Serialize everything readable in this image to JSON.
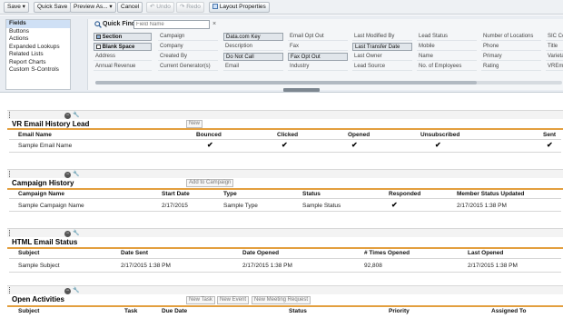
{
  "toolbar": {
    "save": "Save ▾",
    "quick_save": "Quick Save",
    "preview_as": "Preview As... ▾",
    "cancel": "Cancel",
    "undo": "Undo",
    "redo": "Redo",
    "layout_properties": "Layout Properties"
  },
  "palette": {
    "categories": [
      "Fields",
      "Buttons",
      "Actions",
      "Expanded Lookups",
      "Related Lists",
      "Report Charts",
      "Custom S-Controls"
    ],
    "selected_category": "Fields",
    "quick_find_label": "Quick Find",
    "quick_find_placeholder": "Field Name",
    "clear_icon": "×",
    "fields": [
      [
        "Section",
        "Campaign",
        "Data.com Key",
        "Email Opt Out",
        "Last Modified By",
        "Lead Status",
        "Number of Locations",
        "SIC Co"
      ],
      [
        "Blank Space",
        "Company",
        "Description",
        "Fax",
        "Last Transfer Date",
        "Mobile",
        "Phone",
        "Title"
      ],
      [
        "Address",
        "Created By",
        "Do Not Call",
        "Fax Opt Out",
        "Last Owner",
        "Name",
        "Primary",
        "Varieta"
      ],
      [
        "Annual Revenue",
        "Current Generator(s)",
        "Email",
        "Industry",
        "Lead Source",
        "No. of Employees",
        "Rating",
        "VREmp"
      ]
    ]
  },
  "sections": {
    "vr": {
      "title": "VR Email History Lead",
      "button": "New",
      "columns": [
        "Email Name",
        "Bounced",
        "Clicked",
        "Opened",
        "Unsubscribed",
        "Sent"
      ],
      "row": [
        "Sample Email Name",
        "✔",
        "✔",
        "✔",
        "✔",
        "✔"
      ]
    },
    "campaign": {
      "title": "Campaign History",
      "button": "Add to Campaign",
      "columns": [
        "Campaign Name",
        "Start Date",
        "Type",
        "Status",
        "Responded",
        "Member Status Updated"
      ],
      "row": [
        "Sample Campaign Name",
        "2/17/2015",
        "Sample Type",
        "Sample Status",
        "✔",
        "2/17/2015 1:38 PM"
      ]
    },
    "html": {
      "title": "HTML Email Status",
      "columns": [
        "Subject",
        "Date Sent",
        "Date Opened",
        "# Times Opened",
        "Last Opened"
      ],
      "row": [
        "Sample Subject",
        "2/17/2015 1:38 PM",
        "2/17/2015 1:38 PM",
        "92,808",
        "2/17/2015 1:38 PM"
      ]
    },
    "activities": {
      "title": "Open Activities",
      "buttons": [
        "New Task",
        "New Event",
        "New Meeting Request"
      ],
      "columns": [
        "Subject",
        "Task",
        "Due Date",
        "Status",
        "Priority",
        "Assigned To"
      ]
    }
  },
  "colors": {
    "accent_rule": "#e39f3f",
    "palette_bg": "#e9edf2"
  },
  "icons": [
    "search-icon",
    "section-icon",
    "blank-space-icon",
    "undo-icon",
    "redo-icon",
    "layout-icon",
    "minus-icon",
    "wrench-icon"
  ]
}
